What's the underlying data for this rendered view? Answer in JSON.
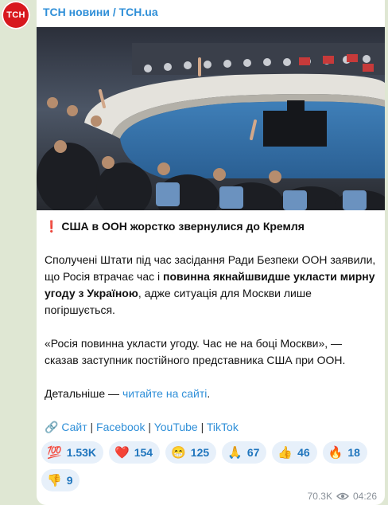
{
  "channel": {
    "avatar_text": "ТСН",
    "name": "ТСН новини / TCH.ua"
  },
  "post": {
    "headline_icon": "❗",
    "headline": "США в ООН жорстко звернулися до Кремля",
    "p1_a": "Сполучені Штати під час засідання Ради Безпеки ООН заявили, що Росія втрачає час і ",
    "p1_bold": "повинна якнайшвидше укласти мирну угоду з Україною",
    "p1_b": ", адже ситуація для Москви лише погіршується.",
    "p2": "«Росія повинна укласти угоду. Час не на боці Москви», — сказав заступник постійного представника США при ООН.",
    "p3_prefix": "Детальніше — ",
    "p3_link": "читайте на сайті",
    "p3_suffix": "."
  },
  "links": {
    "chain_icon": "🔗",
    "items": [
      "Сайт",
      "Facebook",
      "YouTube",
      "TikTok"
    ],
    "separator": "|"
  },
  "reactions": [
    {
      "emoji": "💯",
      "count": "1.53K"
    },
    {
      "emoji": "❤️",
      "count": "154"
    },
    {
      "emoji": "😁",
      "count": "125"
    },
    {
      "emoji": "🙏",
      "count": "67"
    },
    {
      "emoji": "👍",
      "count": "46"
    },
    {
      "emoji": "🔥",
      "count": "18"
    },
    {
      "emoji": "👎",
      "count": "9"
    }
  ],
  "meta": {
    "views": "70.3K",
    "time": "04:26"
  }
}
